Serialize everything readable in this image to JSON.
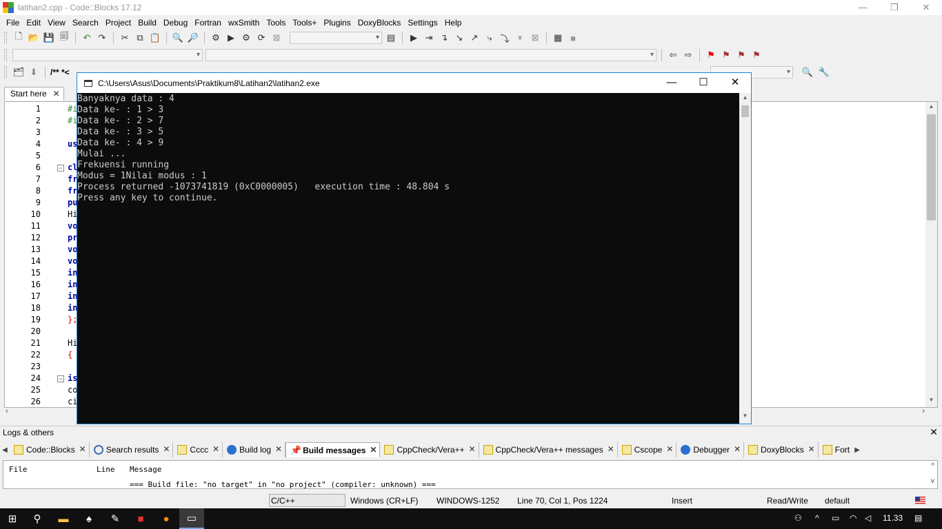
{
  "window": {
    "title": "latihan2.cpp - Code::Blocks 17.12",
    "minimize": "—",
    "restore": "❐",
    "close": "✕"
  },
  "menu": [
    "File",
    "Edit",
    "View",
    "Search",
    "Project",
    "Build",
    "Debug",
    "Fortran",
    "wxSmith",
    "Tools",
    "Tools+",
    "Plugins",
    "DoxyBlocks",
    "Settings",
    "Help"
  ],
  "toolbar3": {
    "comment_label": "/** *<"
  },
  "editor": {
    "tab_label": "Start here",
    "tab_close": "✕",
    "line_numbers": [
      "1",
      "2",
      "3",
      "4",
      "5",
      "6",
      "7",
      "8",
      "9",
      "10",
      "11",
      "12",
      "13",
      "14",
      "15",
      "16",
      "17",
      "18",
      "19",
      "20",
      "21",
      "22",
      "23",
      "24",
      "25",
      "26"
    ],
    "code_lines": [
      "#i",
      "#i",
      "",
      "us",
      "",
      "cl",
      "fr",
      "fr",
      "pu",
      "Hi",
      "vo",
      "pr",
      "vo",
      "vo",
      "in",
      "in",
      "in",
      "in",
      "};",
      "",
      "Hi",
      "{",
      "",
      "is",
      "co",
      "ci"
    ]
  },
  "console": {
    "title": "C:\\Users\\Asus\\Documents\\Praktikum8\\Latihan2\\latihan2.exe",
    "lines": [
      "Banyaknya data : 4",
      "Data ke- : 1 > 3",
      "Data ke- : 2 > 7",
      "Data ke- : 3 > 5",
      "Data ke- : 4 > 9",
      "Mulai ...",
      "Frekuensi running",
      "Modus = 1Nilai modus : 1",
      "Process returned -1073741819 (0xC0000005)   execution time : 48.804 s",
      "Press any key to continue."
    ]
  },
  "logs": {
    "title": "Logs & others",
    "close": "✕",
    "tabs": [
      "Code::Blocks",
      "Search results",
      "Cccc",
      "Build log",
      "Build messages",
      "CppCheck/Vera++",
      "CppCheck/Vera++ messages",
      "Cscope",
      "Debugger",
      "DoxyBlocks",
      "Fort"
    ],
    "active_tab": "Build messages",
    "columns": [
      "File",
      "Line",
      "Message"
    ],
    "rows": [
      "=== Build file: \"no target\" in \"no project\" (compiler: unknown) ==="
    ]
  },
  "status": {
    "language": "C/C++",
    "line_ending": "Windows (CR+LF)",
    "encoding": "WINDOWS-1252",
    "position": "Line 70, Col 1, Pos 1224",
    "mode": "Insert",
    "access": "Read/Write",
    "profile": "default"
  },
  "taskbar": {
    "time": "11.33"
  },
  "colors": {
    "console_bg": "#0c0c0c",
    "console_fg": "#cccccc",
    "preprocessor": "#2e8b2e",
    "keyword": "#0000a0"
  }
}
